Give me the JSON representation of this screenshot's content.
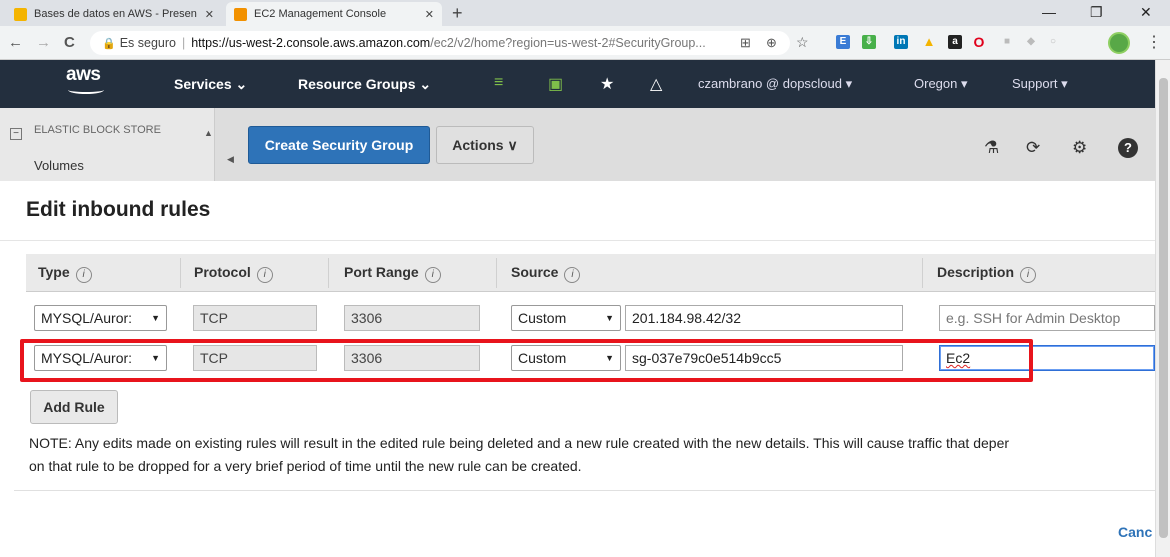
{
  "browser": {
    "tabs": [
      {
        "title": "Bases de datos en AWS - Presen",
        "favicon_color": "#f4b400",
        "active": false
      },
      {
        "title": "EC2 Management Console",
        "favicon_color": "#f29100",
        "active": true
      }
    ],
    "new_tab": "+",
    "window_controls": [
      "—",
      "❐",
      "✕"
    ],
    "nav": {
      "back": "←",
      "forward": "→",
      "reload": "C"
    },
    "address": {
      "lock": "🔒",
      "secure_label": "Es seguro",
      "separator": "|",
      "host": "https://us-west-2.console.aws.amazon.com",
      "path": "/ec2/v2/home?region=us-west-2#SecurityGroup..."
    },
    "toolbar_icons": [
      {
        "name": "translate-icon",
        "glyph": "⊞",
        "color": "#666"
      },
      {
        "name": "zoom-icon",
        "glyph": "⊕",
        "color": "#666"
      },
      {
        "name": "bookmark-star-icon",
        "glyph": "☆",
        "color": "#444"
      }
    ],
    "extensions": [
      {
        "name": "ext-icon-1",
        "glyph": "E",
        "color": "#3a7bd5"
      },
      {
        "name": "ext-icon-2",
        "glyph": "⇩",
        "color": "#48b04a"
      },
      {
        "name": "linkedin-icon",
        "glyph": "in",
        "color": "#0077b5"
      },
      {
        "name": "drive-icon",
        "glyph": "▲",
        "color": "#f4b400"
      },
      {
        "name": "amazon-icon",
        "glyph": "a",
        "color": "#222"
      },
      {
        "name": "opera-icon",
        "glyph": "O",
        "color": "#e0001b"
      },
      {
        "name": "ext-icon-3",
        "glyph": "■",
        "color": "#bbb"
      },
      {
        "name": "ext-icon-4",
        "glyph": "◆",
        "color": "#bbb"
      },
      {
        "name": "ext-icon-5",
        "glyph": "○",
        "color": "#bbb"
      }
    ]
  },
  "aws_nav": {
    "logo": "aws",
    "services": "Services",
    "resource_groups": "Resource Groups",
    "chevron": "⌄",
    "user": "czambrano @ dopscloud",
    "region": "Oregon",
    "support": "Support"
  },
  "console": {
    "sidebar_section": "ELASTIC BLOCK STORE",
    "sidebar_item": "Volumes",
    "create_button": "Create Security Group",
    "actions_button": "Actions",
    "actions_caret": "∨",
    "toolbar_glyphs": {
      "flask": "⚗",
      "refresh": "⟳",
      "settings": "⚙",
      "help": "?"
    }
  },
  "modal": {
    "title": "Edit inbound rules",
    "columns": {
      "type": "Type",
      "protocol": "Protocol",
      "port_range": "Port Range",
      "source": "Source",
      "description": "Description"
    },
    "info_glyph": "i",
    "rules": [
      {
        "type": "MYSQL/Auror:",
        "protocol": "TCP",
        "port_range": "3306",
        "source_type": "Custom",
        "source": "201.184.98.42/32",
        "description": "",
        "description_placeholder": "e.g. SSH for Admin Desktop"
      },
      {
        "type": "MYSQL/Auror:",
        "protocol": "TCP",
        "port_range": "3306",
        "source_type": "Custom",
        "source": "sg-037e79c0e514b9cc5",
        "description": "Ec2",
        "description_placeholder": ""
      }
    ],
    "dropdown_arrow": "▼",
    "add_rule": "Add Rule",
    "note_line1": "NOTE: Any edits made on existing rules will result in the edited rule being deleted and a new rule created with the new details. This will cause traffic that deper",
    "note_line2": "on that rule to be dropped for a very brief period of time until the new rule can be created.",
    "cancel": "Canc",
    "highlight_color": "#e8141c",
    "primary_color": "#2e73b8",
    "nav_bg": "#232f3e"
  }
}
